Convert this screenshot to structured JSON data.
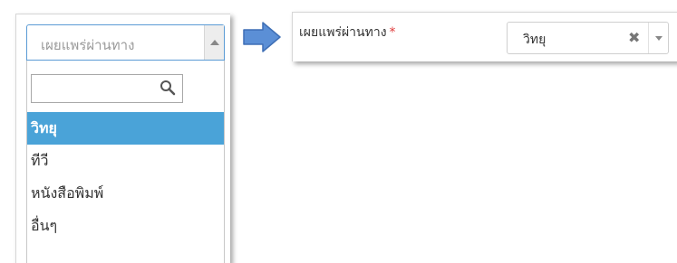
{
  "left_dropdown": {
    "placeholder": "เผยแพร่ผ่านทาง",
    "search_value": "",
    "options": [
      {
        "label": "วิทยุ",
        "selected": true
      },
      {
        "label": "ทีวี",
        "selected": false
      },
      {
        "label": "หนังสือพิมพ์",
        "selected": false
      },
      {
        "label": "อื่นๆ",
        "selected": false
      }
    ]
  },
  "right_field": {
    "label": "เผยแพร่ผ่านทาง",
    "required_mark": "*",
    "selected_value": "วิทยุ",
    "clear_symbol": "✖"
  },
  "icons": {
    "search": "search-icon",
    "clear": "clear-icon",
    "arrow_up": "chevron-up-icon",
    "arrow_down": "chevron-down-icon",
    "flow_arrow": "arrow-right-icon"
  },
  "colors": {
    "selected_option_bg": "#4aa3d8",
    "flow_arrow_fill": "#5b8fd6",
    "required_star": "#e03c3c",
    "focus_border": "#5b9bd5"
  }
}
